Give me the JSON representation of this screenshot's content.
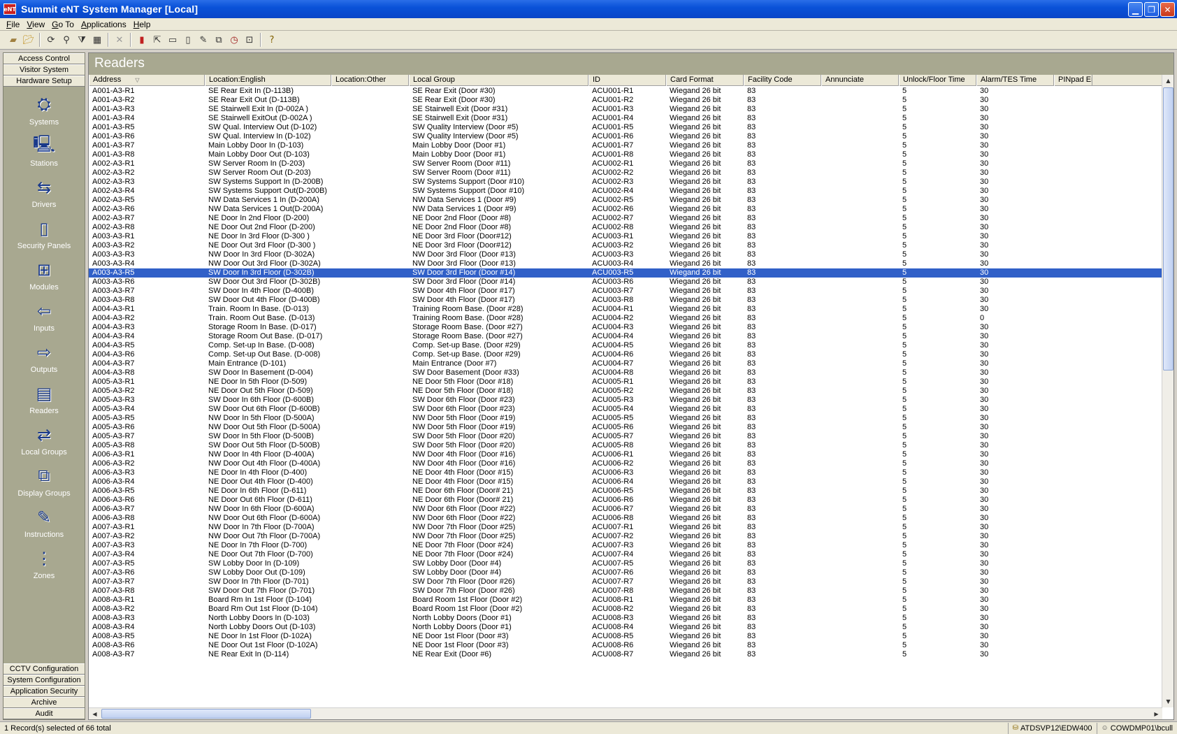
{
  "window": {
    "title": "Summit eNT System Manager [Local]",
    "app_icon_text": "eNT"
  },
  "menu": [
    "File",
    "View",
    "Go To",
    "Applications",
    "Help"
  ],
  "sidebar": {
    "top_buttons": [
      "Access Control",
      "Visitor System",
      "Hardware Setup"
    ],
    "items": [
      {
        "label": "Systems",
        "icon": "systems-icon",
        "glyph": "⛭"
      },
      {
        "label": "Stations",
        "icon": "stations-icon",
        "glyph": "🖳"
      },
      {
        "label": "Drivers",
        "icon": "drivers-icon",
        "glyph": "⇆"
      },
      {
        "label": "Security Panels",
        "icon": "security-panel-icon",
        "glyph": "▯"
      },
      {
        "label": "Modules",
        "icon": "modules-icon",
        "glyph": "⊞"
      },
      {
        "label": "Inputs",
        "icon": "inputs-icon",
        "glyph": "⇦"
      },
      {
        "label": "Outputs",
        "icon": "outputs-icon",
        "glyph": "⇨"
      },
      {
        "label": "Readers",
        "icon": "readers-icon",
        "glyph": "▤"
      },
      {
        "label": "Local Groups",
        "icon": "local-groups-icon",
        "glyph": "⇄"
      },
      {
        "label": "Display Groups",
        "icon": "display-groups-icon",
        "glyph": "⧉"
      },
      {
        "label": "Instructions",
        "icon": "instructions-icon",
        "glyph": "✎"
      },
      {
        "label": "Zones",
        "icon": "zones-icon",
        "glyph": "⋮"
      }
    ],
    "bottom_buttons": [
      "CCTV Configuration",
      "System Configuration",
      "Application Security",
      "Archive",
      "Audit"
    ]
  },
  "panel": {
    "title": "Readers",
    "columns": [
      "Address",
      "Location:English",
      "Location:Other",
      "Local Group",
      "ID",
      "Card Format",
      "Facility Code",
      "Annunciate",
      "Unlock/Floor Time",
      "Alarm/TES Time",
      "PINpad En"
    ],
    "selected_index": 20,
    "rows": [
      [
        "A001-A3-R1",
        "SE Rear Exit In (D-113B)",
        "",
        "SE Rear Exit (Door #30)",
        "ACU001-R1",
        "Wiegand 26 bit",
        "83",
        "",
        "5",
        "30"
      ],
      [
        "A001-A3-R2",
        "SE Rear Exit Out (D-113B)",
        "",
        "SE Rear Exit (Door #30)",
        "ACU001-R2",
        "Wiegand 26 bit",
        "83",
        "",
        "5",
        "30"
      ],
      [
        "A001-A3-R3",
        "SE Stairwell Exit In (D-002A )",
        "",
        "SE Stairwell Exit (Door #31)",
        "ACU001-R3",
        "Wiegand 26 bit",
        "83",
        "",
        "5",
        "30"
      ],
      [
        "A001-A3-R4",
        "SE Stairwell ExitOut (D-002A )",
        "",
        "SE Stairwell Exit (Door #31)",
        "ACU001-R4",
        "Wiegand 26 bit",
        "83",
        "",
        "5",
        "30"
      ],
      [
        "A001-A3-R5",
        "SW Qual. Interview Out (D-102)",
        "",
        "SW Quality Interview (Door #5)",
        "ACU001-R5",
        "Wiegand 26 bit",
        "83",
        "",
        "5",
        "30"
      ],
      [
        "A001-A3-R6",
        "SW Qual. Interview In (D-102)",
        "",
        "SW Quality Interview (Door #5)",
        "ACU001-R6",
        "Wiegand 26 bit",
        "83",
        "",
        "5",
        "30"
      ],
      [
        "A001-A3-R7",
        "Main Lobby Door In (D-103)",
        "",
        "Main Lobby Door (Door #1)",
        "ACU001-R7",
        "Wiegand 26 bit",
        "83",
        "",
        "5",
        "30"
      ],
      [
        "A001-A3-R8",
        "Main Lobby Door Out (D-103)",
        "",
        "Main Lobby Door (Door #1)",
        "ACU001-R8",
        "Wiegand 26 bit",
        "83",
        "",
        "5",
        "30"
      ],
      [
        "A002-A3-R1",
        "SW Server Room In (D-203)",
        "",
        "SW Server Room (Door #11)",
        "ACU002-R1",
        "Wiegand 26 bit",
        "83",
        "",
        "5",
        "30"
      ],
      [
        "A002-A3-R2",
        "SW Server Room Out (D-203)",
        "",
        "SW Server Room (Door #11)",
        "ACU002-R2",
        "Wiegand 26 bit",
        "83",
        "",
        "5",
        "30"
      ],
      [
        "A002-A3-R3",
        "SW Systems Support In (D-200B)",
        "",
        "SW Systems Support (Door #10)",
        "ACU002-R3",
        "Wiegand 26 bit",
        "83",
        "",
        "5",
        "30"
      ],
      [
        "A002-A3-R4",
        "SW Systems Support Out(D-200B)",
        "",
        "SW Systems Support (Door #10)",
        "ACU002-R4",
        "Wiegand 26 bit",
        "83",
        "",
        "5",
        "30"
      ],
      [
        "A002-A3-R5",
        "NW Data Services 1 In (D-200A)",
        "",
        "NW Data Services 1 (Door #9)",
        "ACU002-R5",
        "Wiegand 26 bit",
        "83",
        "",
        "5",
        "30"
      ],
      [
        "A002-A3-R6",
        "NW Data Services 1 Out(D-200A)",
        "",
        "NW Data Services 1 (Door #9)",
        "ACU002-R6",
        "Wiegand 26 bit",
        "83",
        "",
        "5",
        "30"
      ],
      [
        "A002-A3-R7",
        "NE Door In 2nd Floor (D-200)",
        "",
        "NE Door 2nd Floor (Door #8)",
        "ACU002-R7",
        "Wiegand 26 bit",
        "83",
        "",
        "5",
        "30"
      ],
      [
        "A002-A3-R8",
        "NE Door Out 2nd Floor (D-200)",
        "",
        "NE Door 2nd Floor (Door #8)",
        "ACU002-R8",
        "Wiegand 26 bit",
        "83",
        "",
        "5",
        "30"
      ],
      [
        "A003-A3-R1",
        "NE Door In 3rd Floor (D-300 )",
        "",
        "NE Door 3rd Floor (Door#12)",
        "ACU003-R1",
        "Wiegand 26 bit",
        "83",
        "",
        "5",
        "30"
      ],
      [
        "A003-A3-R2",
        "NE Door Out 3rd Floor (D-300 )",
        "",
        "NE Door 3rd Floor (Door#12)",
        "ACU003-R2",
        "Wiegand 26 bit",
        "83",
        "",
        "5",
        "30"
      ],
      [
        "A003-A3-R3",
        "NW Door In 3rd Floor (D-302A)",
        "",
        "NW Door 3rd Floor (Door #13)",
        "ACU003-R3",
        "Wiegand 26 bit",
        "83",
        "",
        "5",
        "30"
      ],
      [
        "A003-A3-R4",
        "NW Door Out 3rd Floor (D-302A)",
        "",
        "NW Door 3rd Floor (Door #13)",
        "ACU003-R4",
        "Wiegand 26 bit",
        "83",
        "",
        "5",
        "30"
      ],
      [
        "A003-A3-R5",
        "SW Door In 3rd Floor (D-302B)",
        "",
        "SW Door 3rd Floor (Door #14)",
        "ACU003-R5",
        "Wiegand 26 bit",
        "83",
        "",
        "5",
        "30"
      ],
      [
        "A003-A3-R6",
        "SW Door Out 3rd Floor (D-302B)",
        "",
        "SW Door 3rd Floor (Door #14)",
        "ACU003-R6",
        "Wiegand 26 bit",
        "83",
        "",
        "5",
        "30"
      ],
      [
        "A003-A3-R7",
        "SW Door In 4th Floor (D-400B)",
        "",
        "SW Door 4th Floor (Door #17)",
        "ACU003-R7",
        "Wiegand 26 bit",
        "83",
        "",
        "5",
        "30"
      ],
      [
        "A003-A3-R8",
        "SW Door Out 4th Floor (D-400B)",
        "",
        "SW Door 4th Floor (Door #17)",
        "ACU003-R8",
        "Wiegand 26 bit",
        "83",
        "",
        "5",
        "30"
      ],
      [
        "A004-A3-R1",
        "Train. Room In Base. (D-013)",
        "",
        "Training Room Base. (Door #28)",
        "ACU004-R1",
        "Wiegand 26 bit",
        "83",
        "",
        "5",
        "30"
      ],
      [
        "A004-A3-R2",
        "Train. Room Out Base. (D-013)",
        "",
        "Training Room Base. (Door #28)",
        "ACU004-R2",
        "Wiegand 26 bit",
        "83",
        "",
        "5",
        "0"
      ],
      [
        "A004-A3-R3",
        "Storage Room In Base. (D-017)",
        "",
        "Storage Room Base. (Door #27)",
        "ACU004-R3",
        "Wiegand 26 bit",
        "83",
        "",
        "5",
        "30"
      ],
      [
        "A004-A3-R4",
        "Storage Room Out Base. (D-017)",
        "",
        "Storage Room Base. (Door #27)",
        "ACU004-R4",
        "Wiegand 26 bit",
        "83",
        "",
        "5",
        "30"
      ],
      [
        "A004-A3-R5",
        "Comp. Set-up In Base. (D-008)",
        "",
        "Comp. Set-up Base. (Door #29)",
        "ACU004-R5",
        "Wiegand 26 bit",
        "83",
        "",
        "5",
        "30"
      ],
      [
        "A004-A3-R6",
        "Comp. Set-up Out Base. (D-008)",
        "",
        "Comp. Set-up Base. (Door #29)",
        "ACU004-R6",
        "Wiegand 26 bit",
        "83",
        "",
        "5",
        "30"
      ],
      [
        "A004-A3-R7",
        "Main Entrance (D-101)",
        "",
        "Main Entrance (Door #7)",
        "ACU004-R7",
        "Wiegand 26 bit",
        "83",
        "",
        "5",
        "30"
      ],
      [
        "A004-A3-R8",
        "SW Door In Basement (D-004)",
        "",
        "SW Door Basement  (Door #33)",
        "ACU004-R8",
        "Wiegand 26 bit",
        "83",
        "",
        "5",
        "30"
      ],
      [
        "A005-A3-R1",
        "NE Door In 5th Floor (D-509)",
        "",
        "NE Door 5th Floor (Door #18)",
        "ACU005-R1",
        "Wiegand 26 bit",
        "83",
        "",
        "5",
        "30"
      ],
      [
        "A005-A3-R2",
        "NE Door Out 5th Floor (D-509)",
        "",
        "NE Door 5th Floor (Door #18)",
        "ACU005-R2",
        "Wiegand 26 bit",
        "83",
        "",
        "5",
        "30"
      ],
      [
        "A005-A3-R3",
        "SW Door In 6th Floor (D-600B)",
        "",
        "SW Door 6th Floor (Door #23)",
        "ACU005-R3",
        "Wiegand 26 bit",
        "83",
        "",
        "5",
        "30"
      ],
      [
        "A005-A3-R4",
        "SW Door Out 6th Floor (D-600B)",
        "",
        "SW Door 6th Floor (Door #23)",
        "ACU005-R4",
        "Wiegand 26 bit",
        "83",
        "",
        "5",
        "30"
      ],
      [
        "A005-A3-R5",
        "NW Door In 5th Floor (D-500A)",
        "",
        "NW Door 5th Floor (Door #19)",
        "ACU005-R5",
        "Wiegand 26 bit",
        "83",
        "",
        "5",
        "30"
      ],
      [
        "A005-A3-R6",
        "NW Door Out 5th Floor (D-500A)",
        "",
        "NW Door 5th Floor (Door #19)",
        "ACU005-R6",
        "Wiegand 26 bit",
        "83",
        "",
        "5",
        "30"
      ],
      [
        "A005-A3-R7",
        "SW Door In 5th Floor (D-500B)",
        "",
        "SW Door 5th Floor (Door #20)",
        "ACU005-R7",
        "Wiegand 26 bit",
        "83",
        "",
        "5",
        "30"
      ],
      [
        "A005-A3-R8",
        "SW Door Out 5th Floor (D-500B)",
        "",
        "SW Door 5th Floor (Door #20)",
        "ACU005-R8",
        "Wiegand 26 bit",
        "83",
        "",
        "5",
        "30"
      ],
      [
        "A006-A3-R1",
        "NW Door In 4th Floor (D-400A)",
        "",
        "NW Door 4th Floor (Door #16)",
        "ACU006-R1",
        "Wiegand 26 bit",
        "83",
        "",
        "5",
        "30"
      ],
      [
        "A006-A3-R2",
        "NW Door Out 4th Floor (D-400A)",
        "",
        "NW Door 4th Floor (Door #16)",
        "ACU006-R2",
        "Wiegand 26 bit",
        "83",
        "",
        "5",
        "30"
      ],
      [
        "A006-A3-R3",
        "NE Door In 4th Floor (D-400)",
        "",
        "NE Door 4th Floor (Door #15)",
        "ACU006-R3",
        "Wiegand 26 bit",
        "83",
        "",
        "5",
        "30"
      ],
      [
        "A006-A3-R4",
        "NE Door Out 4th Floor (D-400)",
        "",
        "NE Door 4th Floor (Door #15)",
        "ACU006-R4",
        "Wiegand 26 bit",
        "83",
        "",
        "5",
        "30"
      ],
      [
        "A006-A3-R5",
        "NE Door In 6th Floor (D-611)",
        "",
        "NE Door 6th Floor (Door# 21)",
        "ACU006-R5",
        "Wiegand 26 bit",
        "83",
        "",
        "5",
        "30"
      ],
      [
        "A006-A3-R6",
        "NE Door Out 6th Floor (D-611)",
        "",
        "NE Door 6th Floor (Door# 21)",
        "ACU006-R6",
        "Wiegand 26 bit",
        "83",
        "",
        "5",
        "30"
      ],
      [
        "A006-A3-R7",
        "NW Door In 6th Floor (D-600A)",
        "",
        "NW Door 6th Floor (Door #22)",
        "ACU006-R7",
        "Wiegand 26 bit",
        "83",
        "",
        "5",
        "30"
      ],
      [
        "A006-A3-R8",
        "NW Door Out 6th Floor (D-600A)",
        "",
        "NW Door 6th Floor (Door #22)",
        "ACU006-R8",
        "Wiegand 26 bit",
        "83",
        "",
        "5",
        "30"
      ],
      [
        "A007-A3-R1",
        "NW Door In 7th Floor (D-700A)",
        "",
        "NW Door 7th Floor (Door #25)",
        "ACU007-R1",
        "Wiegand 26 bit",
        "83",
        "",
        "5",
        "30"
      ],
      [
        "A007-A3-R2",
        "NW Door Out 7th Floor (D-700A)",
        "",
        "NW Door 7th Floor (Door #25)",
        "ACU007-R2",
        "Wiegand 26 bit",
        "83",
        "",
        "5",
        "30"
      ],
      [
        "A007-A3-R3",
        "NE Door In 7th Floor (D-700)",
        "",
        "NE Door 7th Floor (Door #24)",
        "ACU007-R3",
        "Wiegand 26 bit",
        "83",
        "",
        "5",
        "30"
      ],
      [
        "A007-A3-R4",
        "NE Door Out 7th Floor (D-700)",
        "",
        "NE Door 7th Floor (Door #24)",
        "ACU007-R4",
        "Wiegand 26 bit",
        "83",
        "",
        "5",
        "30"
      ],
      [
        "A007-A3-R5",
        "SW Lobby  Door In (D-109)",
        "",
        "SW Lobby Door (Door #4)",
        "ACU007-R5",
        "Wiegand 26 bit",
        "83",
        "",
        "5",
        "30"
      ],
      [
        "A007-A3-R6",
        "SW Lobby Door Out (D-109)",
        "",
        "SW Lobby Door (Door #4)",
        "ACU007-R6",
        "Wiegand 26 bit",
        "83",
        "",
        "5",
        "30"
      ],
      [
        "A007-A3-R7",
        "SW Door In 7th Floor (D-701)",
        "",
        "SW Door 7th Floor (Door #26)",
        "ACU007-R7",
        "Wiegand 26 bit",
        "83",
        "",
        "5",
        "30"
      ],
      [
        "A007-A3-R8",
        "SW Door Out 7th Floor (D-701)",
        "",
        "SW Door 7th Floor (Door #26)",
        "ACU007-R8",
        "Wiegand 26 bit",
        "83",
        "",
        "5",
        "30"
      ],
      [
        "A008-A3-R1",
        "Board Rm In 1st Floor (D-104)",
        "",
        "Board Room 1st Floor (Door #2)",
        "ACU008-R1",
        "Wiegand 26 bit",
        "83",
        "",
        "5",
        "30"
      ],
      [
        "A008-A3-R2",
        "Board Rm Out 1st Floor (D-104)",
        "",
        "Board Room 1st Floor (Door #2)",
        "ACU008-R2",
        "Wiegand 26 bit",
        "83",
        "",
        "5",
        "30"
      ],
      [
        "A008-A3-R3",
        "North Lobby Doors In (D-103)",
        "",
        "North Lobby Doors (Door #1)",
        "ACU008-R3",
        "Wiegand 26 bit",
        "83",
        "",
        "5",
        "30"
      ],
      [
        "A008-A3-R4",
        "North Lobby Doors Out (D-103)",
        "",
        "North Lobby Doors (Door #1)",
        "ACU008-R4",
        "Wiegand 26 bit",
        "83",
        "",
        "5",
        "30"
      ],
      [
        "A008-A3-R5",
        "NE Door In 1st Floor (D-102A)",
        "",
        "NE Door 1st Floor (Door #3)",
        "ACU008-R5",
        "Wiegand 26 bit",
        "83",
        "",
        "5",
        "30"
      ],
      [
        "A008-A3-R6",
        "NE Door Out 1st Floor (D-102A)",
        "",
        "NE Door 1st Floor (Door #3)",
        "ACU008-R6",
        "Wiegand 26 bit",
        "83",
        "",
        "5",
        "30"
      ],
      [
        "A008-A3-R7",
        "NE Rear Exit In (D-114)",
        "",
        "NE Rear Exit (Door #6)",
        "ACU008-R7",
        "Wiegand 26 bit",
        "83",
        "",
        "5",
        "30"
      ]
    ]
  },
  "status": {
    "left": "1 Record(s) selected of 66 total",
    "server": "ATDSVP12\\EDW400",
    "user": "COWDMP01\\bcull"
  }
}
